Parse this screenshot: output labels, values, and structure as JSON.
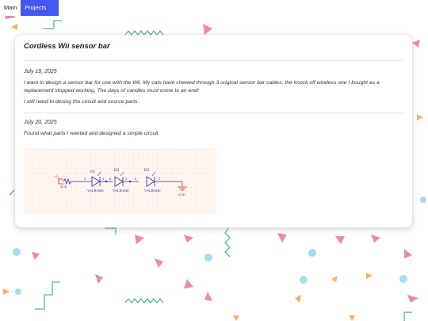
{
  "nav": {
    "tabs": [
      {
        "label": "Main",
        "active": false
      },
      {
        "label": "Projects",
        "active": true
      }
    ],
    "accent_color": "#4357f2"
  },
  "card": {
    "title": "Cordless Wii sensor bar",
    "entries": [
      {
        "date": "July 19, 2025",
        "paragraphs": [
          "I want to design a sensor bar for use with the Wii. My cats have chewed through 3 original sensor bar cables, the knock off wireless one I bought as a replacement stopped working. The days of candles must come to an end!",
          "I still need to desing the circuit and source parts."
        ]
      },
      {
        "date": "July 20, 2025",
        "paragraphs": [
          "Found what parts I wanted and designed a simple circuit."
        ]
      }
    ]
  },
  "schematic": {
    "labels": {
      "source_ref": "+5",
      "source_value": "4.7k",
      "d1_ref": "D1",
      "d2_ref": "D2",
      "d3_ref": "D3",
      "d1_part": "VSLB3940",
      "d2_part": "VSLB3940",
      "d3_part": "VSLB3940",
      "ground": "GND",
      "pin_2": "2",
      "pin_1": "1"
    },
    "colors": {
      "wire": "#2a2a9c",
      "power": "#c0392b",
      "grid": "#fbe3d6",
      "background": "#fdf6f1"
    }
  },
  "background_shapes": {
    "colors": {
      "triangle_pink": "#e88ab3",
      "triangle_orange": "#f3ae6c",
      "circle_blue": "#a9dde8",
      "zigzag_green": "#5ab58d"
    }
  }
}
